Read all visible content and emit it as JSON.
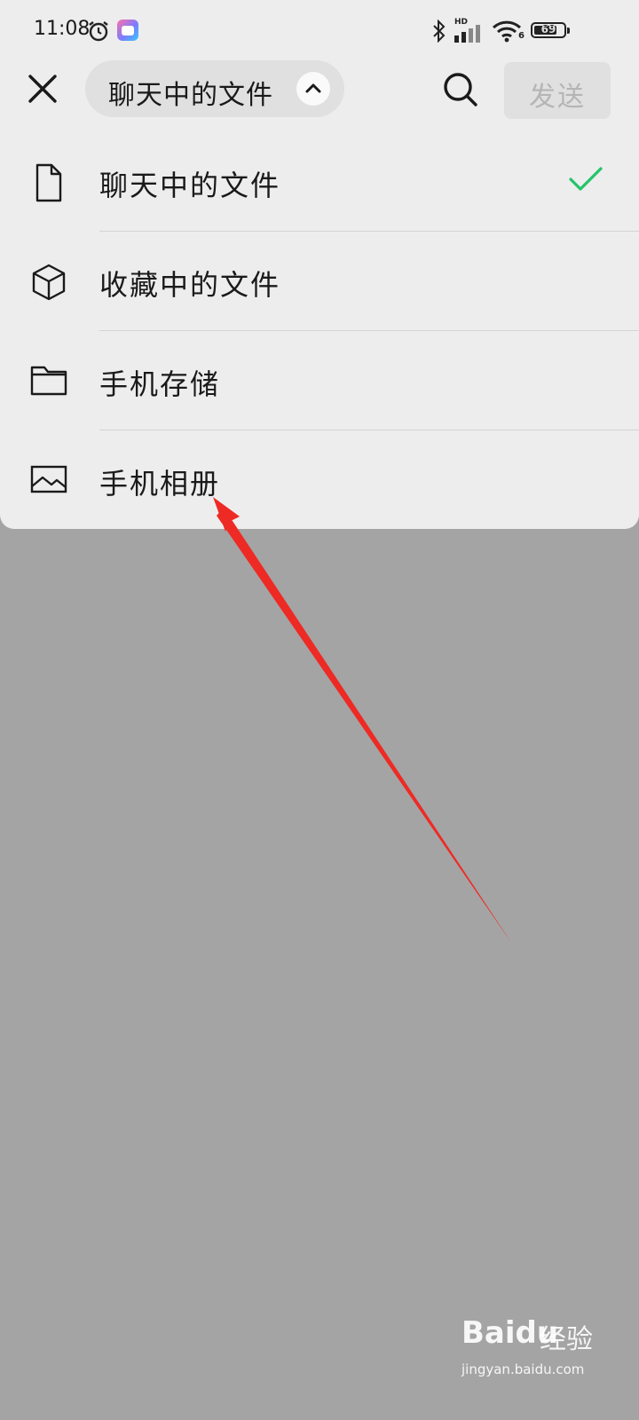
{
  "status_bar": {
    "time": "11:08",
    "network_label": "HD",
    "network_sub": "6",
    "battery_level": "69",
    "icons": [
      "alarm-icon",
      "gallery-app-icon",
      "bluetooth-icon",
      "signal-icon",
      "wifi-icon",
      "battery-icon"
    ]
  },
  "header": {
    "close_icon": "close-icon",
    "source_selector_label": "聊天中的文件",
    "selector_icon": "chevron-up-icon",
    "search_icon": "search-icon",
    "send_label": "发送"
  },
  "menu": {
    "items": [
      {
        "label": "聊天中的文件",
        "icon": "document-icon",
        "selected": true
      },
      {
        "label": "收藏中的文件",
        "icon": "cube-icon",
        "selected": false
      },
      {
        "label": "手机存储",
        "icon": "folder-icon",
        "selected": false
      },
      {
        "label": "手机相册",
        "icon": "image-icon",
        "selected": false
      }
    ],
    "selected_marker_icon": "checkmark-icon",
    "accent_color": "#23c46b"
  },
  "annotation": {
    "arrow_color": "#ee2a24"
  },
  "watermark": {
    "logo_bai": "Bai",
    "logo_du": "du",
    "logo_jingyan": "经验",
    "url": "jingyan.baidu.com"
  }
}
